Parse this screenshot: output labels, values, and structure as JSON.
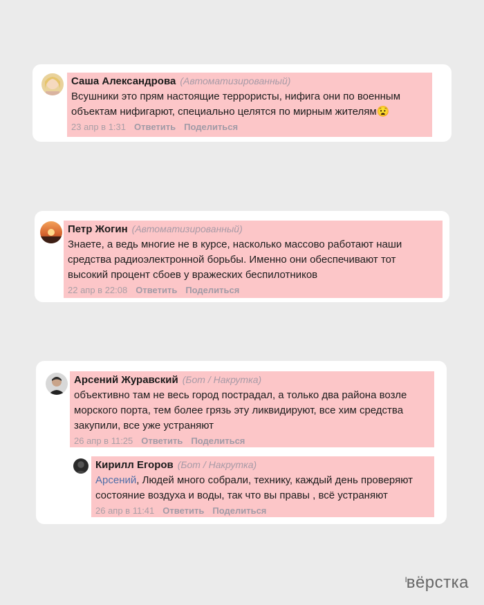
{
  "comments": [
    {
      "author": "Саша Александрова",
      "tag": "(Автоматизированный)",
      "text": "Всушники это прям настоящие террористы, нифига они по военным объектам нифигарют, специально целятся по мирным жителям😧",
      "date": "23 апр в 1:31",
      "reply": "Ответить",
      "share": "Поделиться"
    },
    {
      "author": "Петр Жогин",
      "tag": "(Автоматизированный)",
      "text": "Знаете, а ведь многие не в курсе, насколько массово работают наши средства радиоэлектронной борьбы. Именно они обеспечивают тот высокий процент сбоев у вражеских беспилотников",
      "date": "22 апр в 22:08",
      "reply": "Ответить",
      "share": "Поделиться"
    },
    {
      "author": "Арсений Журавский",
      "tag": "(Бот / Накрутка)",
      "text": "объективно там не весь город пострадал, а только два района возле морского порта, тем более грязь эту ликвидируют, все хим средства закупили, все уже устраняют",
      "date": "26 апр в 11:25",
      "reply": "Ответить",
      "share": "Поделиться"
    },
    {
      "author": "Кирилл Егоров",
      "tag": "(Бот / Накрутка)",
      "mention": "Арсений",
      "text": ", Людей много собрали, технику, каждый день проверяют состояние воздуха и воды, так что вы правы , всё устраняют",
      "date": "26 апр в 11:41",
      "reply": "Ответить",
      "share": "Поделиться"
    }
  ],
  "brand": "вёрстка",
  "colors": {
    "background": "#ebebeb",
    "card": "#ffffff",
    "highlight": "#fcc6c8",
    "mention": "#4f6fa8"
  }
}
